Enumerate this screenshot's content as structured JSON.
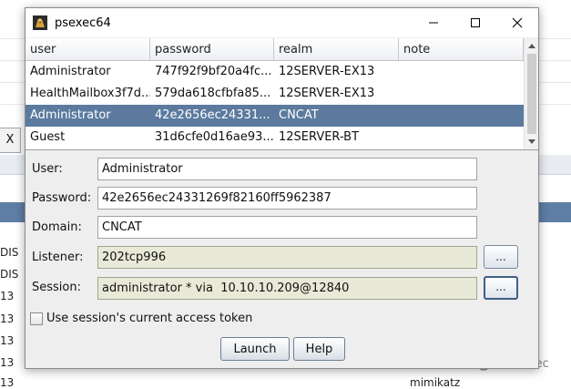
{
  "window": {
    "title": "psexec64"
  },
  "table": {
    "columns": [
      "user",
      "password",
      "realm",
      "note"
    ],
    "rows": [
      {
        "user": "Administrator",
        "password": "747f92f9bf20a4fc...",
        "realm": "12SERVER-EX13",
        "note": ""
      },
      {
        "user": "HealthMailbox3f7d...",
        "password": "579da618cfbfa85...",
        "realm": "12SERVER-EX13",
        "note": ""
      },
      {
        "user": "Administrator",
        "password": "42e2656ec24331...",
        "realm": "CNCAT",
        "note": ""
      },
      {
        "user": "Guest",
        "password": "31d6cfe0d16ae93...",
        "realm": "12SERVER-BT",
        "note": ""
      }
    ],
    "selected_row": 2
  },
  "form": {
    "user_label": "User:",
    "user_value": "Administrator",
    "password_label": "Password:",
    "password_value": "42e2656ec24331269f82160ff5962387",
    "domain_label": "Domain:",
    "domain_value": "CNCAT",
    "listener_label": "Listener:",
    "listener_value": "202tcp996",
    "session_label": "Session:",
    "session_value": "administrator * via  10.10.10.209@12840",
    "browse_label": "...",
    "checkbox_label": "Use session's current access token",
    "checkbox_checked": false
  },
  "buttons": {
    "launch": "Launch",
    "help": "Help"
  },
  "background": {
    "tab_label": "X",
    "left_cells": [
      "DIS",
      "DIS",
      "13",
      "13",
      "13",
      "13",
      "13"
    ],
    "right_cells": [
      "mimikatz"
    ],
    "watermark": "moonsec"
  },
  "colors": {
    "selection": "#5b7a9e",
    "readonly_field": "#e9e9d7",
    "background_strip": "#5f7ea6"
  }
}
